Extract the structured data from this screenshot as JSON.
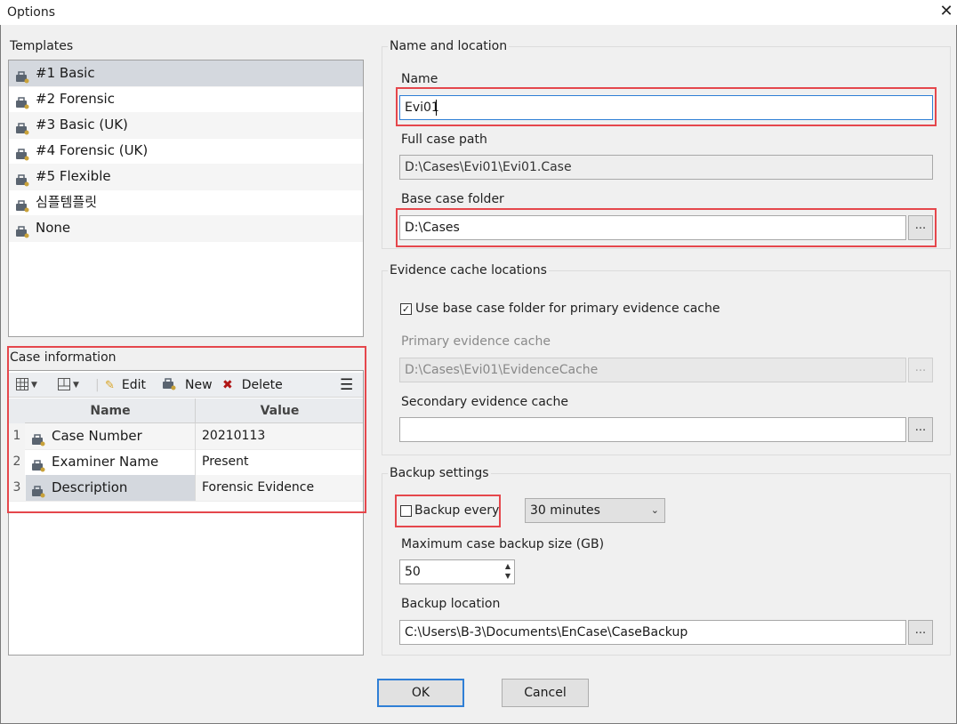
{
  "window": {
    "title": "Options",
    "close_glyph": "✕"
  },
  "templates": {
    "heading": "Templates",
    "items": [
      {
        "label": "#1 Basic",
        "icon": "case-icon"
      },
      {
        "label": "#2 Forensic",
        "icon": "case-icon"
      },
      {
        "label": "#3 Basic (UK)",
        "icon": "case-icon"
      },
      {
        "label": "#4 Forensic (UK)",
        "icon": "case-icon"
      },
      {
        "label": "#5 Flexible",
        "icon": "case-icon"
      },
      {
        "label": "심플템플릿",
        "icon": "case-icon"
      },
      {
        "label": "None",
        "icon": "case-icon"
      }
    ],
    "selected_index": 0
  },
  "case_info": {
    "heading": "Case information",
    "toolbar": {
      "edit": "Edit",
      "new": "New",
      "delete": "Delete"
    },
    "columns": [
      "Name",
      "Value"
    ],
    "rows": [
      {
        "num": "1",
        "name": "Case Number",
        "value": "20210113"
      },
      {
        "num": "2",
        "name": "Examiner Name",
        "value": "Present"
      },
      {
        "num": "3",
        "name": "Description",
        "value": "Forensic Evidence"
      }
    ],
    "selected_index": 2
  },
  "name_location": {
    "group_title": "Name and location",
    "name_label": "Name",
    "name_value": "Evi01",
    "full_path_label": "Full case path",
    "full_path_value": "D:\\Cases\\Evi01\\Evi01.Case",
    "base_folder_label": "Base case folder",
    "base_folder_value": "D:\\Cases",
    "browse_label": "..."
  },
  "evidence_cache": {
    "group_title": "Evidence cache locations",
    "use_base_label": "Use base case folder for primary evidence cache",
    "use_base_checked": true,
    "primary_label": "Primary evidence cache",
    "primary_value": "D:\\Cases\\Evi01\\EvidenceCache",
    "secondary_label": "Secondary evidence cache",
    "secondary_value": "",
    "browse_label": "..."
  },
  "backup": {
    "group_title": "Backup settings",
    "backup_every_label": "Backup every",
    "backup_every_checked": false,
    "interval_value": "30 minutes",
    "max_size_label": "Maximum case backup size (GB)",
    "max_size_value": "50",
    "location_label": "Backup location",
    "location_value": "C:\\Users\\B-3\\Documents\\EnCase\\CaseBackup",
    "browse_label": "..."
  },
  "buttons": {
    "ok": "OK",
    "cancel": "Cancel"
  },
  "colors": {
    "highlight_red": "#e5474c",
    "focus_blue": "#2f7fd6",
    "selection": "#d4d8de"
  }
}
